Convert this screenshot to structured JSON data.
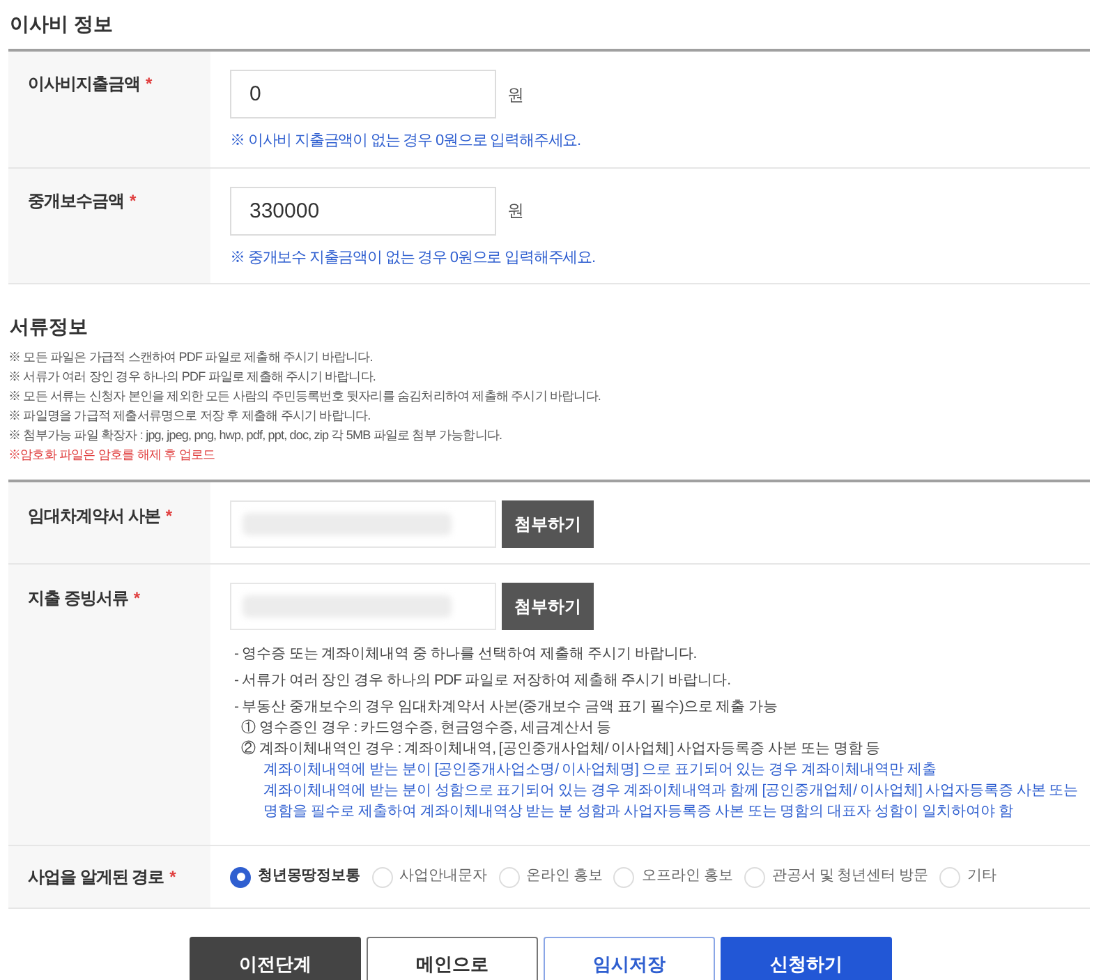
{
  "moving_cost": {
    "title": "이사비 정보",
    "rows": [
      {
        "label": "이사비지출금액",
        "required": "*",
        "value": "0",
        "unit": "원",
        "hint": "※ 이사비 지출금액이 없는 경우 0원으로 입력해주세요."
      },
      {
        "label": "중개보수금액",
        "required": "*",
        "value": "330000",
        "unit": "원",
        "hint": "※ 중개보수 지출금액이 없는 경우 0원으로 입력해주세요."
      }
    ]
  },
  "documents": {
    "title": "서류정보",
    "notes": [
      {
        "text": "※ 모든 파일은 가급적 스캔하여 PDF 파일로 제출해 주시기 바랍니다.",
        "kind": "normal"
      },
      {
        "text": "※ 서류가 여러 장인 경우 하나의 PDF 파일로 제출해 주시기 바랍니다.",
        "kind": "normal"
      },
      {
        "text": "※ 모든 서류는 신청자 본인을 제외한 모든 사람의 주민등록번호 뒷자리를 숨김처리하여 제출해 주시기 바랍니다.",
        "kind": "normal"
      },
      {
        "text": "※ 파일명을 가급적 제출서류명으로 저장 후 제출해 주시기 바랍니다.",
        "kind": "normal"
      },
      {
        "text": "※ 첨부가능 파일 확장자 : jpg, jpeg, png, hwp, pdf, ppt, doc, zip 각 5MB 파일로 첨부 가능합니다.",
        "kind": "normal"
      },
      {
        "text": "※암호화 파일은 암호를 해제 후 업로드",
        "kind": "warning"
      }
    ],
    "rows": [
      {
        "label": "임대차계약서 사본",
        "required": "*",
        "button": "첨부하기",
        "notes": []
      },
      {
        "label": "지출 증빙서류",
        "required": "*",
        "button": "첨부하기",
        "notes": [
          {
            "text": "-  영수증 또는 계좌이체내역 중 하나를 선택하여 제출해 주시기 바랍니다.",
            "kind": "dash"
          },
          {
            "text": "-  서류가 여러 장인 경우 하나의 PDF 파일로 저장하여 제출해 주시기 바랍니다.",
            "kind": "dash"
          },
          {
            "text": "-  부동산 중개보수의 경우 임대차계약서 사본(중개보수 금액 표기 필수)으로 제출 가능",
            "kind": "dash"
          },
          {
            "text": "① 영수증인 경우 : 카드영수증, 현금영수증, 세금계산서 등",
            "kind": "sub"
          },
          {
            "text": "② 계좌이체내역인 경우 : 계좌이체내역, [공인중개사업체/ 이사업체] 사업자등록증 사본 또는 명함 등",
            "kind": "sub"
          },
          {
            "text": "계좌이체내역에 받는 분이 [공인중개사업소명/ 이사업체명] 으로 표기되어 있는 경우 계좌이체내역만 제출",
            "kind": "info"
          },
          {
            "text": "계좌이체내역에 받는 분이 성함으로 표기되어 있는 경우 계좌이체내역과 함께 [공인중개업체/ 이사업체] 사업자등록증 사본 또는 명함을 필수로 제출하여 계좌이체내역상 받는 분 성함과 사업자등록증 사본 또는 명함의 대표자 성함이 일치하여야 함",
            "kind": "info"
          }
        ]
      }
    ],
    "source": {
      "label": "사업을 알게된 경로",
      "required": "*",
      "options": [
        {
          "label": "청년몽땅정보통",
          "selected": true
        },
        {
          "label": "사업안내문자",
          "selected": false
        },
        {
          "label": "온라인 홍보",
          "selected": false
        },
        {
          "label": "오프라인 홍보",
          "selected": false
        },
        {
          "label": "관공서 및 청년센터 방문",
          "selected": false
        },
        {
          "label": "기타",
          "selected": false
        }
      ]
    }
  },
  "buttons": [
    {
      "label": "이전단계",
      "kind": "dark"
    },
    {
      "label": "메인으로",
      "kind": "outline"
    },
    {
      "label": "임시저장",
      "kind": "outline-blue"
    },
    {
      "label": "신청하기",
      "kind": "primary"
    }
  ]
}
